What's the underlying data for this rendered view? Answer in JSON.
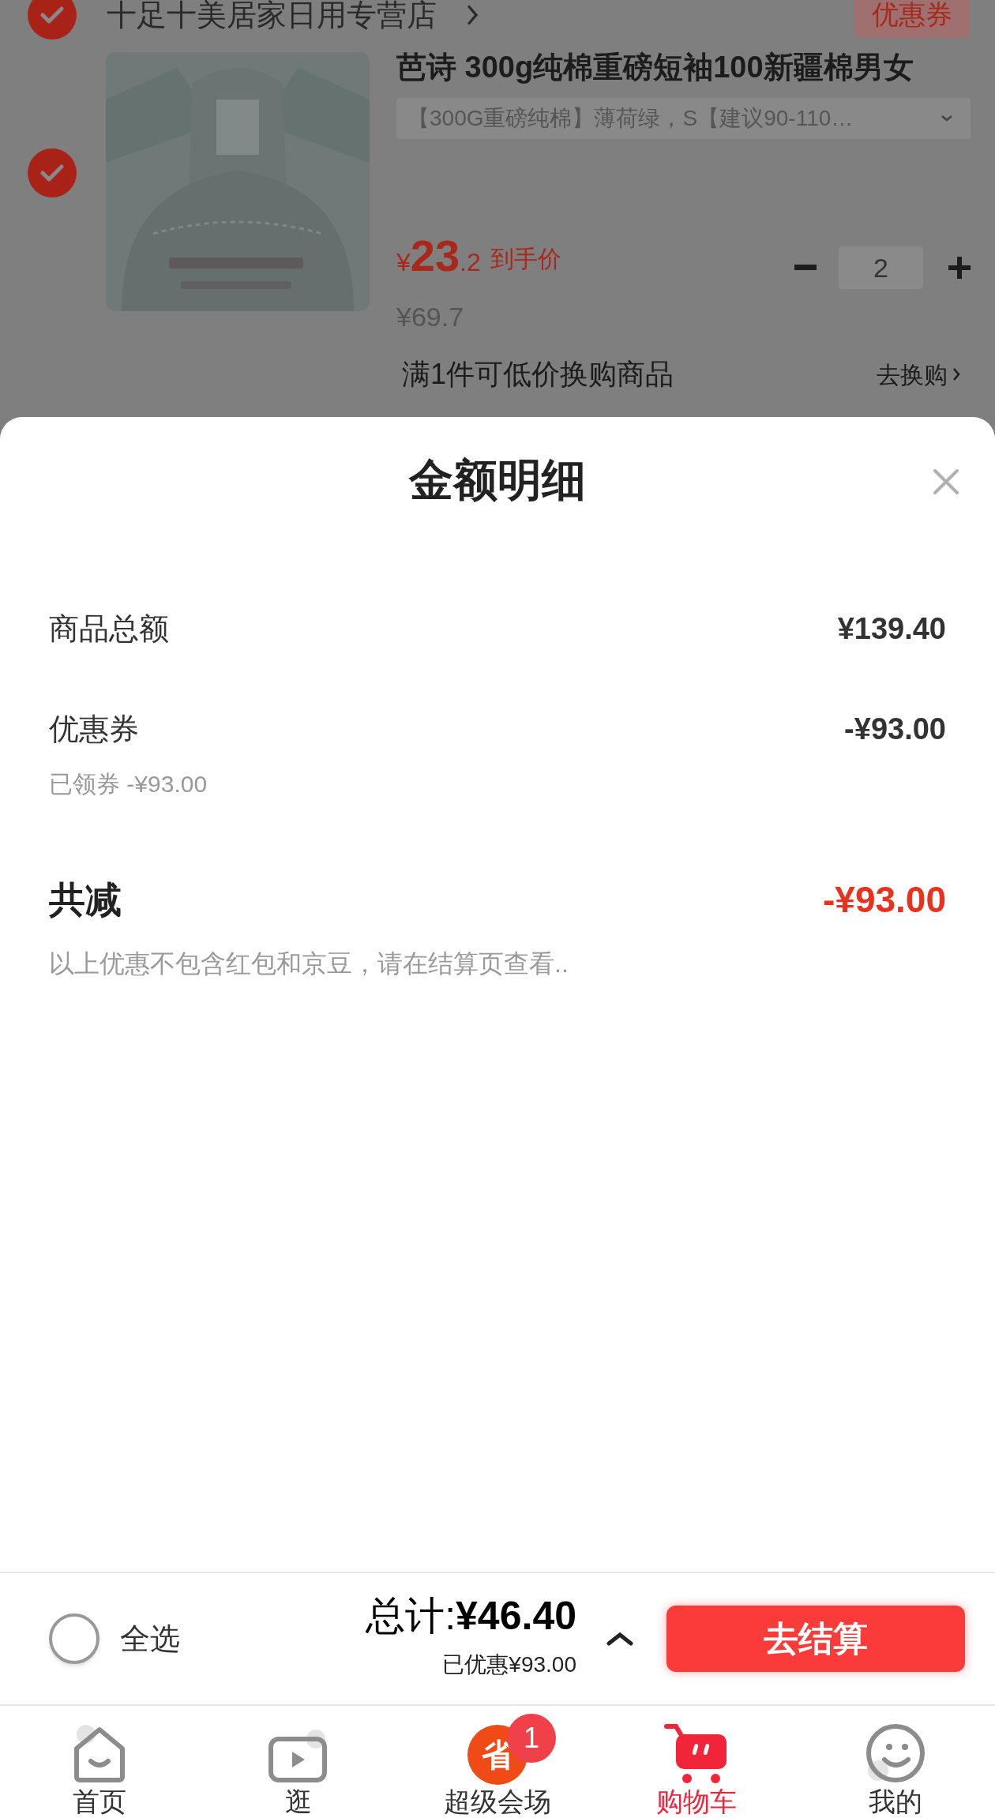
{
  "store": {
    "checked": true,
    "name": "十足十美居家日用专营店",
    "coupon_badge": "优惠券"
  },
  "product": {
    "checked": true,
    "title": "芭诗 300g纯棉重磅短袖100新疆棉男女",
    "sku": "【300G重磅纯棉】薄荷绿，S【建议90-110…",
    "price_currency": "¥",
    "price_int": "23",
    "price_dec": ".2",
    "price_note": "到手价",
    "original_price": "¥69.7",
    "quantity": "2"
  },
  "exchange": {
    "text": "满1件可低价换购商品",
    "link": "去换购"
  },
  "sheet": {
    "title": "金额明细",
    "rows": [
      {
        "kind": "line",
        "label": "商品总额",
        "value": "¥139.40"
      },
      {
        "kind": "line",
        "label": "优惠券",
        "value": "-¥93.00",
        "sub": "已领券 -¥93.00"
      },
      {
        "kind": "total",
        "label": "共减",
        "value": "-¥93.00",
        "note": "以上优惠不包含红包和京豆，请在结算页查看.."
      }
    ]
  },
  "checkout": {
    "select_all": {
      "label": "全选",
      "checked": false
    },
    "total_label": "总计:",
    "total": "¥46.40",
    "saved": "已优惠¥93.00",
    "button": "去结算"
  },
  "tabs": [
    {
      "kind": "home",
      "label": "首页",
      "selected": false
    },
    {
      "kind": "play",
      "label": "逛",
      "selected": false
    },
    {
      "kind": "promo",
      "label": "超级会场",
      "selected": false,
      "icon_text": "省",
      "badge": "1"
    },
    {
      "kind": "cart",
      "label": "购物车",
      "selected": true
    },
    {
      "kind": "face",
      "label": "我的",
      "selected": false
    }
  ]
}
